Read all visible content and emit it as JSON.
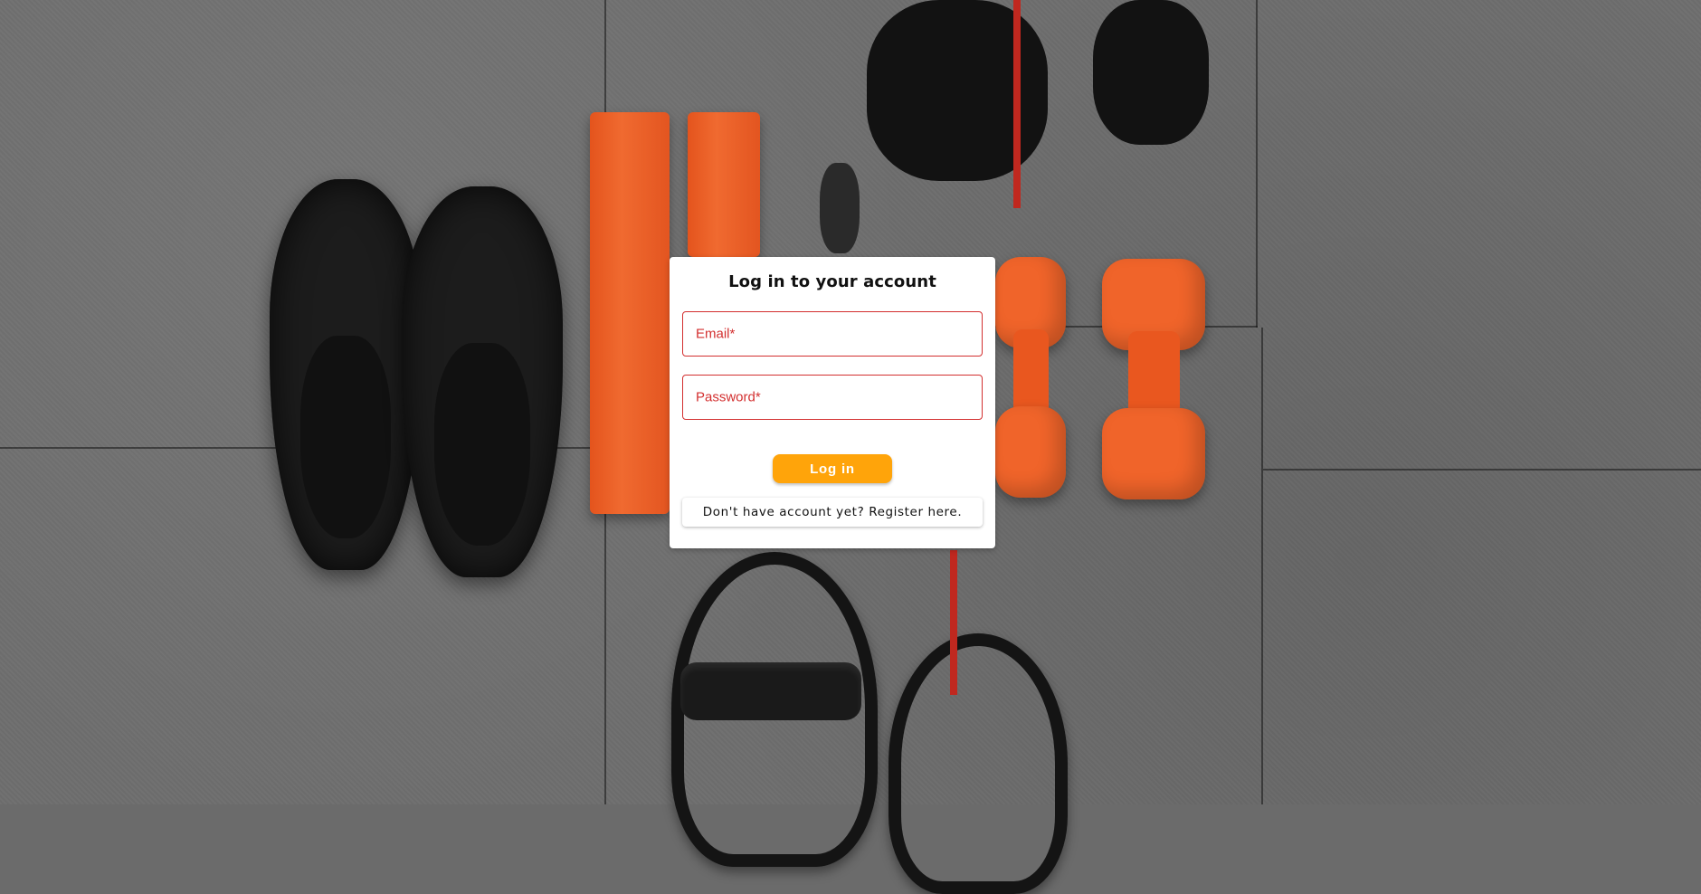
{
  "login": {
    "title": "Log in to your account",
    "email_label": "Email*",
    "password_label": "Password*",
    "login_button": "Log in",
    "register_link": "Don't have account yet? Register here."
  },
  "colors": {
    "error": "#d32f2f",
    "button": "#ffa40a"
  }
}
